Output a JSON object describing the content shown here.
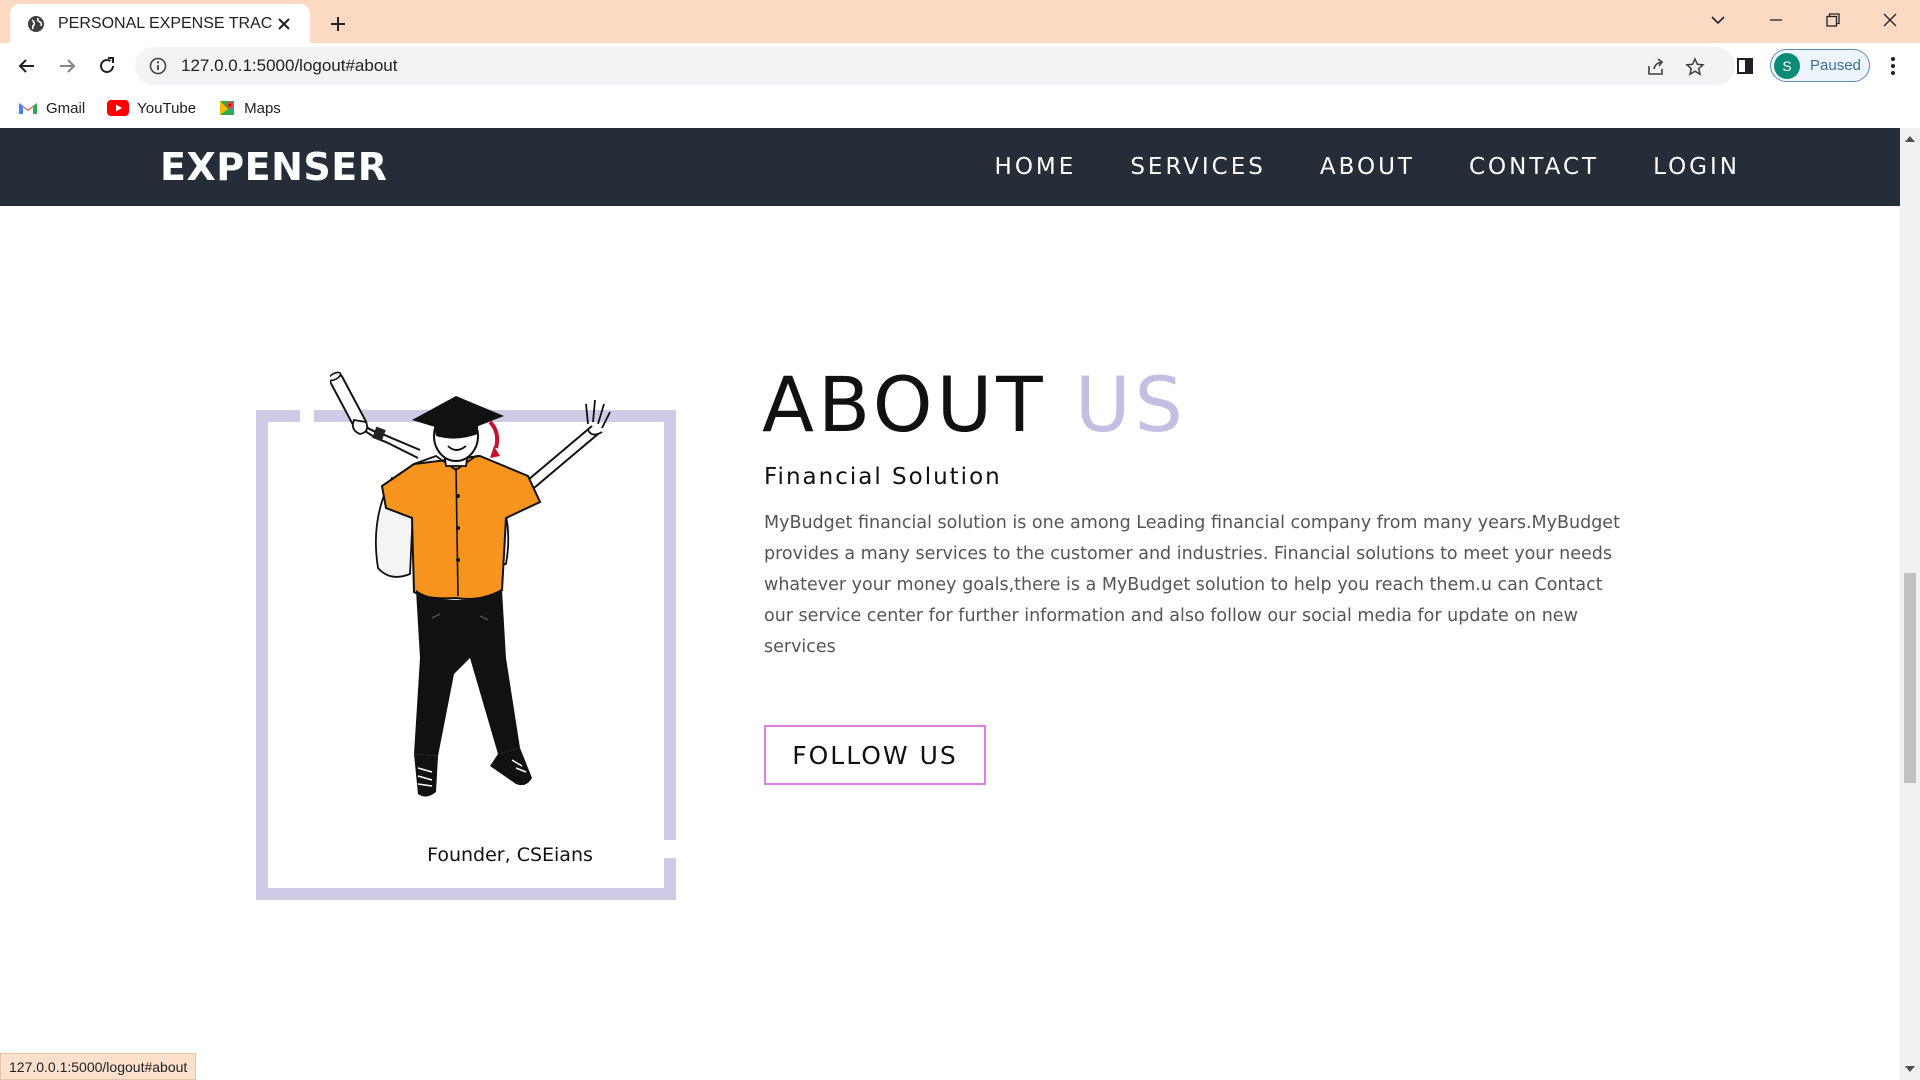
{
  "browser": {
    "tab_title": "PERSONAL EXPENSE TRACKER",
    "url": "127.0.0.1:5000/logout#about",
    "profile_initial": "S",
    "profile_status": "Paused",
    "bookmarks": [
      {
        "label": "Gmail",
        "icon": "gmail-icon"
      },
      {
        "label": "YouTube",
        "icon": "youtube-icon"
      },
      {
        "label": "Maps",
        "icon": "maps-icon"
      }
    ],
    "status_url": "127.0.0.1:5000/logout#about"
  },
  "site": {
    "logo": "EXPENSER",
    "nav": [
      "HOME",
      "SERVICES",
      "ABOUT",
      "CONTACT",
      "LOGIN"
    ]
  },
  "about": {
    "heading_main": "ABOUT",
    "heading_accent": "US",
    "subtitle": "Financial Solution",
    "body": "MyBudget financial solution is one among Leading financial company from many years.MyBudget provides a many services to the customer and industries. Financial solutions to meet your needs whatever your money goals,there is a MyBudget solution to help you reach them.u can Contact our service center for further information and also follow our social media for update on new services",
    "caption": "Founder, CSEians",
    "follow_button": "FOLLOW US"
  },
  "colors": {
    "nav_bg": "#252e38",
    "accent_lavender": "#c3bfe3",
    "frame": "#cfcbe6",
    "follow_border": "#e07ee6",
    "tabbar_bg": "#fcd9c2",
    "shirt_orange": "#f7941d"
  }
}
